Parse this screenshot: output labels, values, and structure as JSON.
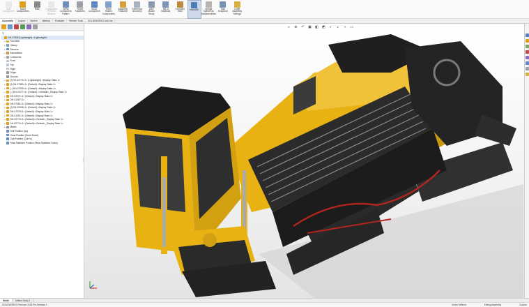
{
  "ribbon": {
    "buttons": [
      {
        "label": "Edit\nComponent",
        "name": "edit-component-button",
        "color": "#c9c9c9",
        "disabled": true
      },
      {
        "label": "Insert\nComponents",
        "name": "insert-components-button",
        "color": "#e0a21c",
        "disabled": false
      },
      {
        "label": "Mate",
        "name": "mate-button",
        "color": "#8a8a8a",
        "disabled": false
      },
      {
        "label": "Component\nPreview\nWindow",
        "name": "component-preview-button",
        "color": "#c9c9c9",
        "disabled": true
      },
      {
        "label": "Linear Component\nPattern",
        "name": "linear-pattern-button",
        "color": "#6d8fb9",
        "disabled": false
      },
      {
        "label": "Smart\nFasteners",
        "name": "smart-fasteners-button",
        "color": "#9aa0a6",
        "disabled": false
      },
      {
        "label": "Move\nComponent",
        "name": "move-component-button",
        "color": "#5d86c4",
        "disabled": false
      },
      {
        "label": "Show\nHidden\nComponents",
        "name": "show-hidden-button",
        "color": "#7fa0c8",
        "disabled": false
      },
      {
        "label": "Assembly\nFeatures",
        "name": "assembly-features-button",
        "color": "#d4a13a",
        "disabled": false
      },
      {
        "label": "Reference\nGeometry",
        "name": "reference-geometry-button",
        "color": "#a8b3c2",
        "disabled": false
      },
      {
        "label": "New\nMotion\nStudy",
        "name": "new-motion-study-button",
        "color": "#8a9bb0",
        "disabled": false
      },
      {
        "label": "Bill of\nMaterials",
        "name": "bill-of-materials-button",
        "color": "#7c96b8",
        "disabled": false
      },
      {
        "label": "Exploded\nView",
        "name": "exploded-view-button",
        "color": "#c08a3a",
        "disabled": false
      },
      {
        "label": "Instant3D",
        "name": "instant3d-button",
        "color": "#4f7db8",
        "disabled": false,
        "active": true
      },
      {
        "label": "Update\nSpeedPak\nSubassemblies",
        "name": "update-speedpak-button",
        "color": "#b4b4b4",
        "disabled": false
      },
      {
        "label": "Take\nSnapshot",
        "name": "take-snapshot-button",
        "color": "#7892b4",
        "disabled": false
      },
      {
        "label": "Large\nAssembly\nSettings",
        "name": "large-assembly-settings-button",
        "color": "#d8b040",
        "disabled": false
      }
    ]
  },
  "command_tabs": [
    "Assembly",
    "Layout",
    "Sketch",
    "Markup",
    "Evaluate",
    "Render Tools",
    "SOLIDWORKS Add-Ins"
  ],
  "panel": {
    "tab_colors": [
      "#e3a21a",
      "#6b9ad1",
      "#c04848",
      "#5a9d5a",
      "#8a6fb8",
      "#9aa0a6"
    ],
    "filter_icon": "filter-icon",
    "tree": [
      {
        "label": "DH-07835 (Lightweight) <Lightweight>",
        "indent": 0,
        "icon_color": "#e0a21c",
        "twisty": "",
        "sel": true
      },
      {
        "label": "Favorites",
        "indent": 1,
        "icon_color": "#d9b23c",
        "twisty": "▸"
      },
      {
        "label": "History",
        "indent": 1,
        "icon_color": "#8aa0b8",
        "twisty": "▸"
      },
      {
        "label": "Sensors",
        "indent": 1,
        "icon_color": "#6b8fc0",
        "twisty": "▸"
      },
      {
        "label": "Annotations",
        "indent": 1,
        "icon_color": "#c89a3a",
        "twisty": "▸"
      },
      {
        "label": "Comments",
        "indent": 1,
        "icon_color": "#a8a8a8",
        "twisty": "▸"
      },
      {
        "label": "Front",
        "indent": 1,
        "icon_color": "#b8c6d8",
        "twisty": ""
      },
      {
        "label": "Top",
        "indent": 1,
        "icon_color": "#b8c6d8",
        "twisty": ""
      },
      {
        "label": "Right",
        "indent": 1,
        "icon_color": "#b8c6d8",
        "twisty": ""
      },
      {
        "label": "Origin",
        "indent": 1,
        "icon_color": "#9a9a9a",
        "twisty": ""
      },
      {
        "label": "Ground",
        "indent": 1,
        "icon_color": "#9a9a9a",
        "twisty": ""
      },
      {
        "label": "(f) DH-02774<1> (Lightweight) <Display State-1>",
        "indent": 1,
        "icon_color": "#e0a21c",
        "twisty": "▸"
      },
      {
        "label": "(f) DH-07380<1> (Default) <Display State-1>",
        "indent": 1,
        "icon_color": "#e0a21c",
        "twisty": "▸"
      },
      {
        "label": "(-) DH-07290<1> (Default) <Display State-1>",
        "indent": 1,
        "icon_color": "#e0a21c",
        "twisty": "▸"
      },
      {
        "label": "(-) DH-07077<1> (Default) <<Default>_Display State 1>",
        "indent": 1,
        "icon_color": "#e0a21c",
        "twisty": "▸"
      },
      {
        "label": "DH-02271<1> (Default) <Display State-1>",
        "indent": 1,
        "icon_color": "#e0a21c",
        "twisty": "▸"
      },
      {
        "label": "DH-01087<1>",
        "indent": 1,
        "icon_color": "#e0a21c",
        "twisty": "▸"
      },
      {
        "label": "DH-07051<1> (Default) <Display State-1>",
        "indent": 1,
        "icon_color": "#e0a21c",
        "twisty": "▸"
      },
      {
        "label": "(f) DH-02005<1> (Default) <Display State-1>",
        "indent": 1,
        "icon_color": "#e0a21c",
        "twisty": "▸"
      },
      {
        "label": "DH-07075<1> (Default) <Display State-1>",
        "indent": 1,
        "icon_color": "#e0a21c",
        "twisty": "▸"
      },
      {
        "label": "DH-01001<1> (Default) <Display State-1>",
        "indent": 1,
        "icon_color": "#e0a21c",
        "twisty": "▸"
      },
      {
        "label": "DH-02773<1> (Default)<<Default>_Display State 1>",
        "indent": 1,
        "icon_color": "#e0a21c",
        "twisty": "▸"
      },
      {
        "label": "DH-02774<1> (Default)<<Default>_Display State 1>",
        "indent": 1,
        "icon_color": "#e0a21c",
        "twisty": "▸"
      },
      {
        "label": "Mates",
        "indent": 1,
        "icon_color": "#8a8a8a",
        "twisty": "▸"
      },
      {
        "label": "Drill Position (Up)",
        "indent": 1,
        "icon_color": "#6b8fc0",
        "twisty": ""
      },
      {
        "label": "Hood Position (Hood Down)",
        "indent": 1,
        "icon_color": "#6b8fc0",
        "twisty": ""
      },
      {
        "label": "Cab Position (Cab In)",
        "indent": 1,
        "icon_color": "#6b8fc0",
        "twisty": ""
      },
      {
        "label": "Rear Stabilizer Position (Rear Stabilizer Down)",
        "indent": 1,
        "icon_color": "#6b8fc0",
        "twisty": ""
      }
    ]
  },
  "viewport": {
    "hud_icons": [
      "zoom-to-fit-icon",
      "zoom-area-icon",
      "previous-view-icon",
      "section-view-icon",
      "view-orientation-icon",
      "display-style-icon",
      "hide-show-icon",
      "edit-appearance-icon",
      "apply-scene-icon",
      "view-settings-icon"
    ],
    "hud_glyphs": [
      "⌕",
      "⊕",
      "↶",
      "▣",
      "◧",
      "◩",
      "◐",
      "◒",
      "◑",
      "▭"
    ],
    "model_colors": {
      "yellow": "#e8b213",
      "dark": "#1f1f1f",
      "grey": "#6d6d6d",
      "red": "#b3261e"
    }
  },
  "taskpane": {
    "icon_colors": [
      "#4f7db8",
      "#e0a21c",
      "#7aa55a",
      "#c04848",
      "#8a6fb8",
      "#5d86c4",
      "#9aa0a6",
      "#d8b040"
    ]
  },
  "bottom_tabs": [
    "Model",
    "Motion Study 1"
  ],
  "status": {
    "left": "SOLIDWORKS Premium 2018 Pre-Release 1",
    "under_defined": "Under Defined",
    "editing": "Editing Assembly",
    "units": "Custom"
  }
}
